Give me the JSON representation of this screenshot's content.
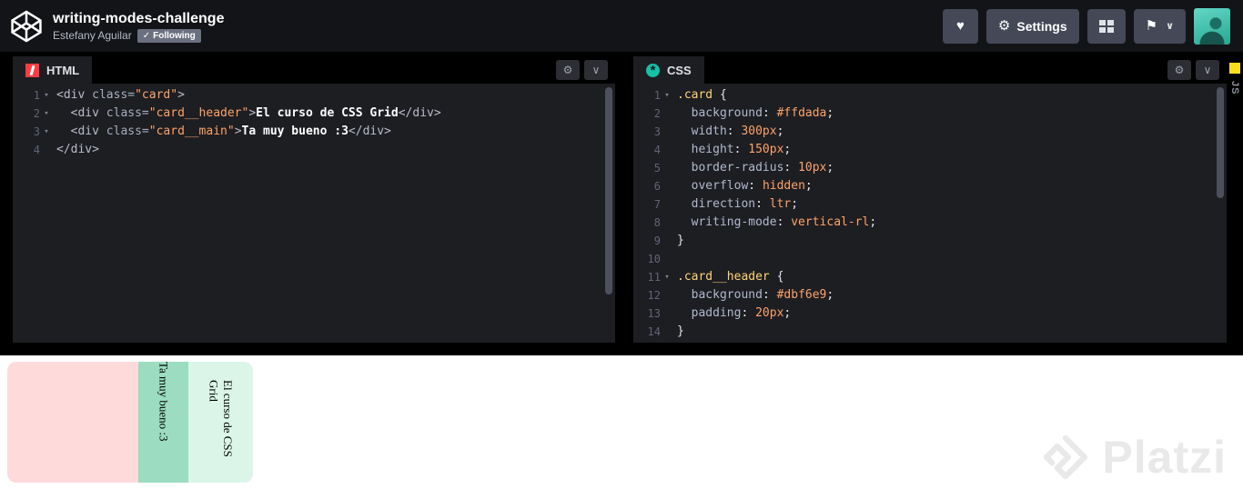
{
  "header": {
    "title": "writing-modes-challenge",
    "author": "Estefany Aguilar",
    "following_label": "Following",
    "settings_label": "Settings"
  },
  "icons": {
    "gear": "⚙",
    "heart": "♥",
    "check": "✓",
    "chevron_down": "∨",
    "flag": "⚑",
    "fold": "▾",
    "asterisk": "*"
  },
  "colors": {
    "html_icon": "#ff3c41",
    "css_icon": "#17c1a6",
    "js_icon": "#f7df1e"
  },
  "editors": {
    "html": {
      "tab": "HTML",
      "lines": [
        {
          "fold": true,
          "tokens": [
            [
              "tag",
              "<div"
            ],
            [
              "pln",
              " "
            ],
            [
              "attr",
              "class="
            ],
            [
              "str",
              "\"card\""
            ],
            [
              "tag",
              ">"
            ]
          ]
        },
        {
          "fold": true,
          "tokens": [
            [
              "pln",
              "  "
            ],
            [
              "tag",
              "<div"
            ],
            [
              "pln",
              " "
            ],
            [
              "attr",
              "class="
            ],
            [
              "str",
              "\"card__header\""
            ],
            [
              "tag",
              ">"
            ],
            [
              "txt",
              "El curso de CSS Grid"
            ],
            [
              "tag",
              "</div>"
            ]
          ]
        },
        {
          "fold": true,
          "tokens": [
            [
              "pln",
              "  "
            ],
            [
              "tag",
              "<div"
            ],
            [
              "pln",
              " "
            ],
            [
              "attr",
              "class="
            ],
            [
              "str",
              "\"card__main\""
            ],
            [
              "tag",
              ">"
            ],
            [
              "txt",
              "Ta muy bueno :3"
            ],
            [
              "tag",
              "</div>"
            ]
          ]
        },
        {
          "tokens": [
            [
              "tag",
              "</div>"
            ]
          ]
        }
      ]
    },
    "css": {
      "tab": "CSS",
      "lines": [
        {
          "fold": true,
          "tokens": [
            [
              "sel",
              ".card"
            ],
            [
              "pun",
              " {"
            ]
          ]
        },
        {
          "tokens": [
            [
              "pln",
              "  "
            ],
            [
              "prop",
              "background"
            ],
            [
              "pun",
              ": "
            ],
            [
              "val",
              "#ffdada"
            ],
            [
              "pun",
              ";"
            ]
          ]
        },
        {
          "tokens": [
            [
              "pln",
              "  "
            ],
            [
              "prop",
              "width"
            ],
            [
              "pun",
              ": "
            ],
            [
              "val",
              "300px"
            ],
            [
              "pun",
              ";"
            ]
          ]
        },
        {
          "tokens": [
            [
              "pln",
              "  "
            ],
            [
              "prop",
              "height"
            ],
            [
              "pun",
              ": "
            ],
            [
              "val",
              "150px"
            ],
            [
              "pun",
              ";"
            ]
          ]
        },
        {
          "tokens": [
            [
              "pln",
              "  "
            ],
            [
              "prop",
              "border-radius"
            ],
            [
              "pun",
              ": "
            ],
            [
              "val",
              "10px"
            ],
            [
              "pun",
              ";"
            ]
          ]
        },
        {
          "tokens": [
            [
              "pln",
              "  "
            ],
            [
              "prop",
              "overflow"
            ],
            [
              "pun",
              ": "
            ],
            [
              "val",
              "hidden"
            ],
            [
              "pun",
              ";"
            ]
          ]
        },
        {
          "tokens": [
            [
              "pln",
              "  "
            ],
            [
              "prop",
              "direction"
            ],
            [
              "pun",
              ": "
            ],
            [
              "val",
              "ltr"
            ],
            [
              "pun",
              ";"
            ]
          ]
        },
        {
          "tokens": [
            [
              "pln",
              "  "
            ],
            [
              "prop",
              "writing-mode"
            ],
            [
              "pun",
              ": "
            ],
            [
              "val",
              "vertical-rl"
            ],
            [
              "pun",
              ";"
            ]
          ]
        },
        {
          "tokens": [
            [
              "pun",
              "}"
            ]
          ]
        },
        {
          "tokens": []
        },
        {
          "fold": true,
          "tokens": [
            [
              "sel",
              ".card__header"
            ],
            [
              "pun",
              " {"
            ]
          ]
        },
        {
          "tokens": [
            [
              "pln",
              "  "
            ],
            [
              "prop",
              "background"
            ],
            [
              "pun",
              ": "
            ],
            [
              "val",
              "#dbf6e9"
            ],
            [
              "pun",
              ";"
            ]
          ]
        },
        {
          "tokens": [
            [
              "pln",
              "  "
            ],
            [
              "prop",
              "padding"
            ],
            [
              "pun",
              ": "
            ],
            [
              "val",
              "20px"
            ],
            [
              "pun",
              ";"
            ]
          ]
        },
        {
          "tokens": [
            [
              "pun",
              "}"
            ]
          ]
        }
      ]
    },
    "js": {
      "tab": "JS"
    }
  },
  "preview": {
    "card": {
      "header_text": "El curso de CSS Grid",
      "main_text": "Ta muy bueno :3",
      "bg": "#ffdada",
      "header_bg": "#dbf6e9",
      "main_bg": "#9cdcc0"
    },
    "watermark": "Platzi"
  }
}
